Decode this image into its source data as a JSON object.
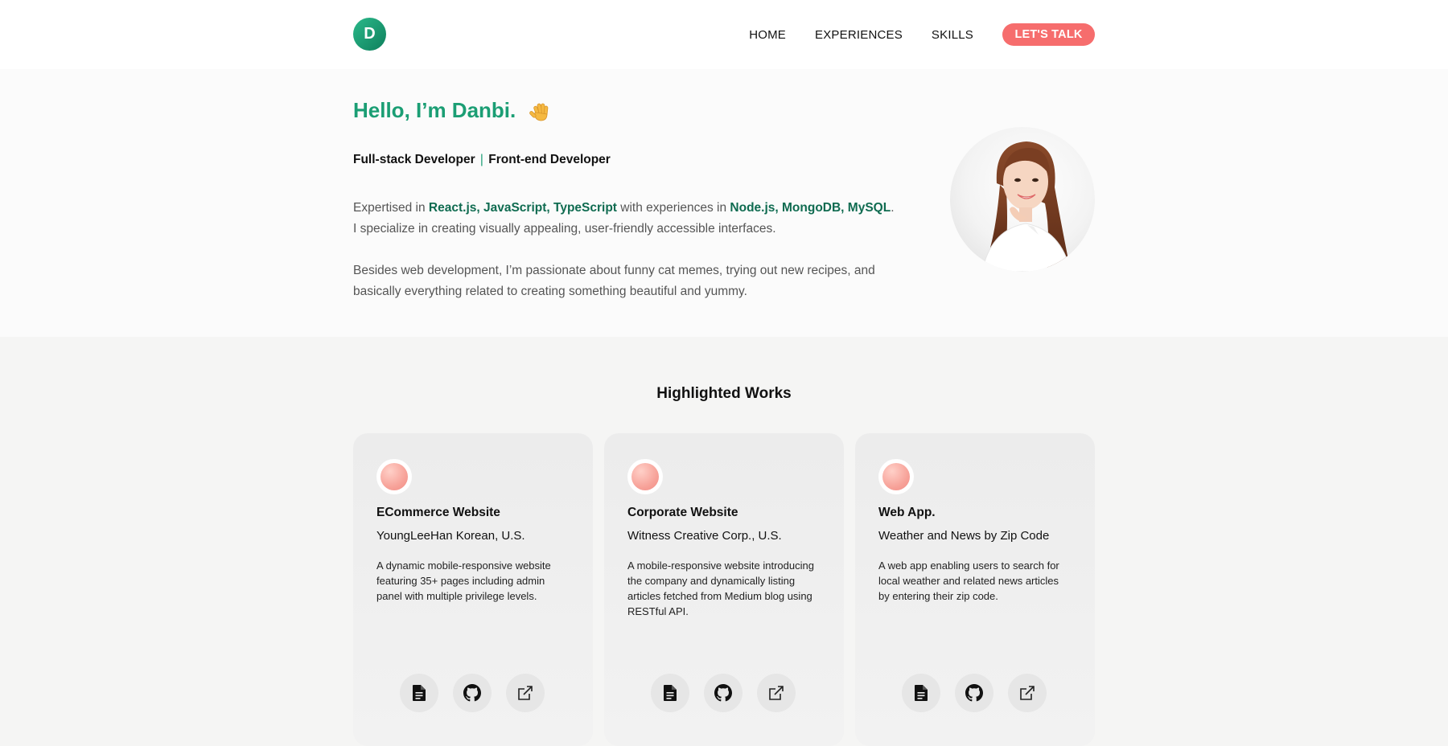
{
  "header": {
    "logo_letter": "D",
    "nav": [
      "HOME",
      "EXPERIENCES",
      "SKILLS"
    ],
    "cta_label": "LET'S TALK"
  },
  "hero": {
    "greeting": "Hello, I’m Danbi.",
    "wave_icon": "waving-hand-icon",
    "role1": "Full-stack Developer",
    "role_sep": "|",
    "role2": "Front-end Developer",
    "bio_prefix": "Expertised in ",
    "bio_skills": "React.js, JavaScript, TypeScript",
    "bio_mid": " with experiences in ",
    "bio_backend": "Node.js, MongoDB, MySQL",
    "bio_end": ".",
    "bio_line2": "I specialize in creating visually appealing, user-friendly accessible interfaces.",
    "bio2": "Besides web development, I’m passionate about funny cat memes, trying out new recipes, and basically everything related to creating something beautiful and yummy."
  },
  "works": {
    "title": "Highlighted Works",
    "cards": [
      {
        "type": "ECommerce Website",
        "client": "YoungLeeHan Korean, U.S.",
        "desc": "A dynamic mobile-responsive website featuring 35+ pages including admin panel with multiple privilege levels."
      },
      {
        "type": "Corporate Website",
        "client": "Witness Creative Corp., U.S.",
        "desc": "A mobile-responsive website introducing the company and dynamically listing articles fetched from Medium blog using RESTful API."
      },
      {
        "type": "Web App.",
        "client": "Weather and News by Zip Code",
        "desc": "A web app enabling users to search for local weather and related news articles by entering their zip code."
      }
    ],
    "icons": [
      "document-icon",
      "github-icon",
      "external-link-icon"
    ]
  },
  "colors": {
    "accent_green": "#1b9e74",
    "dark_green": "#0f6b50",
    "cta_red": "#f66d6d"
  }
}
